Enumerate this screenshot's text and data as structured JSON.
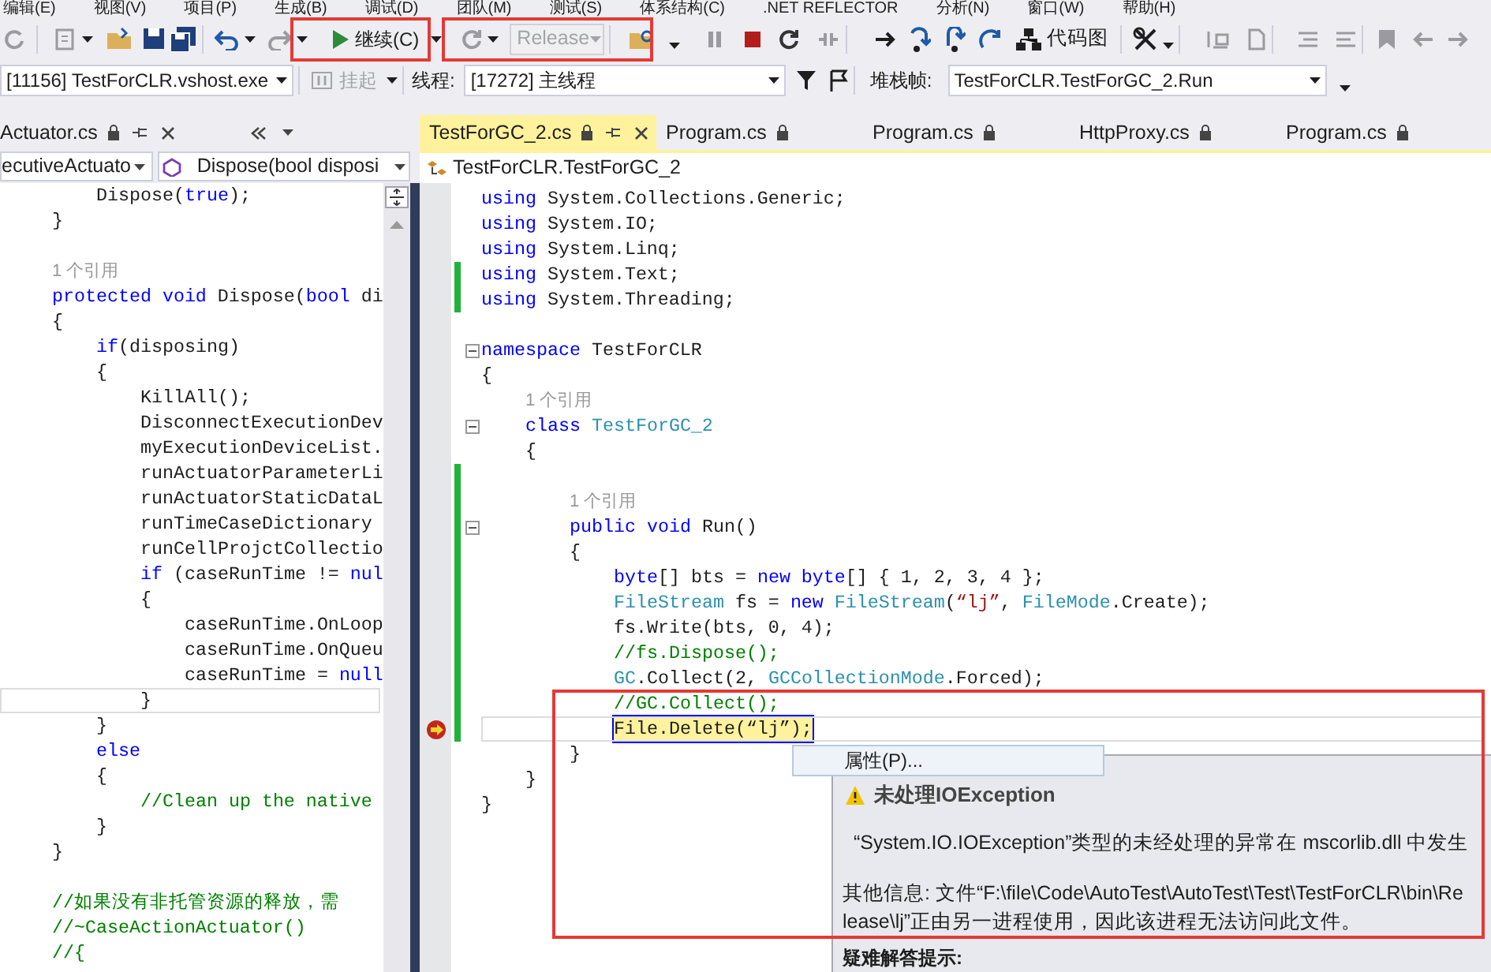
{
  "menu_bar": [
    "编辑(E)",
    "视图(V)",
    "项目(P)",
    "生成(B)",
    "调试(D)",
    "团队(M)",
    "测试(S)",
    "体系结构(C)",
    ".NET REFLECTOR",
    "分析(N)",
    "窗口(W)",
    "帮助(H)"
  ],
  "toolbar": {
    "continue_button": "继续(C)",
    "configuration": {
      "value": "Release",
      "disabled": true
    },
    "code_map_button": "代码图"
  },
  "debug_location": {
    "process": "[11156] TestForCLR.vshost.exe",
    "suspend": {
      "label": "挂起",
      "disabled": true
    },
    "thread_label": "线程:",
    "thread": "[17272] 主线程",
    "stack_frame_label": "堆栈帧:",
    "stack_frame": "TestForCLR.TestForGC_2.Run"
  },
  "left_panel": {
    "tab": "Actuator.cs",
    "type_dropdown": "ecutiveActuato",
    "member_dropdown": "Dispose(bool disposi",
    "lines": [
      {
        "current": false,
        "tokens": [
          {
            "kind": "plain",
            "text": "    Dispose("
          },
          {
            "kind": "kw",
            "text": "true"
          },
          {
            "kind": "plain",
            "text": ");"
          }
        ]
      },
      {
        "current": false,
        "tokens": [
          {
            "kind": "plain",
            "text": "}"
          }
        ]
      },
      {
        "current": false
      },
      {
        "current": false,
        "tokens": [
          {
            "kind": "lens",
            "text": "1 个引用"
          }
        ]
      },
      {
        "current": false,
        "tokens": [
          {
            "kind": "kw",
            "text": "protected void"
          },
          {
            "kind": "plain",
            "text": " Dispose("
          },
          {
            "kind": "kw",
            "text": "bool"
          },
          {
            "kind": "plain",
            "text": " di"
          }
        ]
      },
      {
        "current": false,
        "tokens": [
          {
            "kind": "plain",
            "text": "{"
          }
        ]
      },
      {
        "current": false,
        "tokens": [
          {
            "kind": "kw",
            "text": "    if"
          },
          {
            "kind": "plain",
            "text": "(disposing)"
          }
        ]
      },
      {
        "current": false,
        "tokens": [
          {
            "kind": "plain",
            "text": "    {"
          }
        ]
      },
      {
        "current": false,
        "tokens": [
          {
            "kind": "plain",
            "text": "        KillAll();"
          }
        ]
      },
      {
        "current": false,
        "tokens": [
          {
            "kind": "plain",
            "text": "        DisconnectExecutionDev"
          }
        ]
      },
      {
        "current": false,
        "tokens": [
          {
            "kind": "plain",
            "text": "        myExecutionDeviceList."
          }
        ]
      },
      {
        "current": false,
        "tokens": [
          {
            "kind": "plain",
            "text": "        runActuatorParameterLi"
          }
        ]
      },
      {
        "current": false,
        "tokens": [
          {
            "kind": "plain",
            "text": "        runActuatorStaticDataL"
          }
        ]
      },
      {
        "current": false,
        "tokens": [
          {
            "kind": "plain",
            "text": "        runTimeCaseDictionary"
          }
        ]
      },
      {
        "current": false,
        "tokens": [
          {
            "kind": "plain",
            "text": "        runCellProjctCollectio"
          }
        ]
      },
      {
        "current": false,
        "tokens": [
          {
            "kind": "kw",
            "text": "        if"
          },
          {
            "kind": "plain",
            "text": " (caseRunTime != "
          },
          {
            "kind": "kw",
            "text": "nul"
          }
        ]
      },
      {
        "current": false,
        "tokens": [
          {
            "kind": "plain",
            "text": "        {"
          }
        ]
      },
      {
        "current": false,
        "tokens": [
          {
            "kind": "plain",
            "text": "            caseRunTime.OnLoop"
          }
        ]
      },
      {
        "current": false,
        "tokens": [
          {
            "kind": "plain",
            "text": "            caseRunTime.OnQueu"
          }
        ]
      },
      {
        "current": false,
        "tokens": [
          {
            "kind": "plain",
            "text": "            caseRunTime = "
          },
          {
            "kind": "kw",
            "text": "null"
          }
        ]
      },
      {
        "current": true,
        "tokens": [
          {
            "kind": "plain",
            "text": "        }"
          }
        ]
      },
      {
        "current": false,
        "tokens": [
          {
            "kind": "plain",
            "text": "    }"
          }
        ]
      },
      {
        "current": false,
        "tokens": [
          {
            "kind": "kw",
            "text": "    else"
          }
        ]
      },
      {
        "current": false,
        "tokens": [
          {
            "kind": "plain",
            "text": "    {"
          }
        ]
      },
      {
        "current": false,
        "tokens": [
          {
            "kind": "comment",
            "text": "        //Clean up the native"
          }
        ]
      },
      {
        "current": false,
        "tokens": [
          {
            "kind": "plain",
            "text": "    }"
          }
        ]
      },
      {
        "current": false,
        "tokens": [
          {
            "kind": "plain",
            "text": "}"
          }
        ]
      },
      {
        "current": false
      },
      {
        "current": false,
        "tokens": [
          {
            "kind": "comment",
            "text": "//如果没有非托管资源的释放，需"
          }
        ]
      },
      {
        "current": false,
        "tokens": [
          {
            "kind": "comment",
            "text": "//~CaseActionActuator()"
          }
        ]
      },
      {
        "current": false,
        "tokens": [
          {
            "kind": "comment",
            "text": "//{"
          }
        ]
      }
    ]
  },
  "document_tabs": [
    {
      "label": "TestForGC_2.cs",
      "selected": true
    },
    {
      "label": "Program.cs",
      "selected": false
    },
    {
      "label": "Program.cs",
      "selected": false
    },
    {
      "label": "HttpProxy.cs",
      "selected": false
    },
    {
      "label": "Program.cs",
      "selected": false
    }
  ],
  "editor": {
    "type_dropdown": "TestForCLR.TestForGC_2",
    "lines": [
      {
        "changed": false,
        "fold": false,
        "current": false,
        "execution_point": false,
        "tokens": [
          {
            "kind": "kw",
            "text": "using"
          },
          {
            "kind": "plain",
            "text": " System.Collections.Generic;"
          }
        ]
      },
      {
        "changed": false,
        "fold": false,
        "current": false,
        "execution_point": false,
        "tokens": [
          {
            "kind": "kw",
            "text": "using"
          },
          {
            "kind": "plain",
            "text": " System.IO;"
          }
        ]
      },
      {
        "changed": false,
        "fold": false,
        "current": false,
        "execution_point": false,
        "tokens": [
          {
            "kind": "kw",
            "text": "using"
          },
          {
            "kind": "plain",
            "text": " System.Linq;"
          }
        ]
      },
      {
        "changed": true,
        "fold": false,
        "current": false,
        "execution_point": false,
        "tokens": [
          {
            "kind": "kw",
            "text": "using"
          },
          {
            "kind": "plain",
            "text": " System.Text;"
          }
        ]
      },
      {
        "changed": true,
        "fold": false,
        "current": false,
        "execution_point": false,
        "tokens": [
          {
            "kind": "kw",
            "text": "using"
          },
          {
            "kind": "plain",
            "text": " System.Threading;"
          }
        ]
      },
      {
        "changed": false,
        "fold": false,
        "current": false,
        "execution_point": false
      },
      {
        "changed": false,
        "fold": true,
        "current": false,
        "execution_point": false,
        "tokens": [
          {
            "kind": "kw",
            "text": "namespace"
          },
          {
            "kind": "plain",
            "text": " TestForCLR"
          }
        ]
      },
      {
        "changed": false,
        "fold": false,
        "current": false,
        "execution_point": false,
        "tokens": [
          {
            "kind": "plain",
            "text": "{"
          }
        ]
      },
      {
        "changed": false,
        "fold": false,
        "current": false,
        "execution_point": false,
        "tokens": [
          {
            "kind": "lens",
            "text": "    1 个引用"
          }
        ]
      },
      {
        "changed": false,
        "fold": true,
        "current": false,
        "execution_point": false,
        "tokens": [
          {
            "kind": "kw",
            "text": "    class"
          },
          {
            "kind": "type",
            "text": " TestForGC_2"
          }
        ]
      },
      {
        "changed": false,
        "fold": false,
        "current": false,
        "execution_point": false,
        "tokens": [
          {
            "kind": "plain",
            "text": "    {"
          }
        ]
      },
      {
        "changed": true,
        "fold": false,
        "current": false,
        "execution_point": false
      },
      {
        "changed": true,
        "fold": false,
        "current": false,
        "execution_point": false,
        "tokens": [
          {
            "kind": "lens",
            "text": "        1 个引用"
          }
        ]
      },
      {
        "changed": true,
        "fold": true,
        "current": false,
        "execution_point": false,
        "tokens": [
          {
            "kind": "kw",
            "text": "        public void"
          },
          {
            "kind": "plain",
            "text": " Run()"
          }
        ]
      },
      {
        "changed": true,
        "fold": false,
        "current": false,
        "execution_point": false,
        "tokens": [
          {
            "kind": "plain",
            "text": "        {"
          }
        ]
      },
      {
        "changed": true,
        "fold": false,
        "current": false,
        "execution_point": false,
        "tokens": [
          {
            "kind": "kw",
            "text": "            byte"
          },
          {
            "kind": "plain",
            "text": "[] bts = "
          },
          {
            "kind": "kw",
            "text": "new byte"
          },
          {
            "kind": "plain",
            "text": "[] { 1, 2, 3, 4 };"
          }
        ]
      },
      {
        "changed": true,
        "fold": false,
        "current": false,
        "execution_point": false,
        "tokens": [
          {
            "kind": "type",
            "text": "            FileStream"
          },
          {
            "kind": "plain",
            "text": " fs = "
          },
          {
            "kind": "kw",
            "text": "new"
          },
          {
            "kind": "type",
            "text": " FileStream"
          },
          {
            "kind": "plain",
            "text": "("
          },
          {
            "kind": "str",
            "text": "“lj”"
          },
          {
            "kind": "plain",
            "text": ", "
          },
          {
            "kind": "type",
            "text": "FileMode"
          },
          {
            "kind": "plain",
            "text": ".Create);"
          }
        ]
      },
      {
        "changed": true,
        "fold": false,
        "current": false,
        "execution_point": false,
        "tokens": [
          {
            "kind": "plain",
            "text": "            fs.Write(bts, 0, 4);"
          }
        ]
      },
      {
        "changed": true,
        "fold": false,
        "current": false,
        "execution_point": false,
        "tokens": [
          {
            "kind": "comment",
            "text": "            //fs.Dispose();"
          }
        ]
      },
      {
        "changed": true,
        "fold": false,
        "current": false,
        "execution_point": false,
        "tokens": [
          {
            "kind": "type",
            "text": "            GC"
          },
          {
            "kind": "plain",
            "text": ".Collect(2, "
          },
          {
            "kind": "type",
            "text": "GCCollectionMode"
          },
          {
            "kind": "plain",
            "text": ".Forced);"
          }
        ]
      },
      {
        "changed": true,
        "fold": false,
        "current": false,
        "execution_point": false,
        "tokens": [
          {
            "kind": "comment",
            "text": "            //GC.Collect();"
          }
        ]
      },
      {
        "changed": true,
        "fold": false,
        "current": true,
        "execution_point": true,
        "tokens": [
          {
            "kind": "stmt",
            "text": "            File.Delete(“lj”);"
          }
        ]
      },
      {
        "changed": false,
        "fold": false,
        "current": false,
        "execution_point": false,
        "tokens": [
          {
            "kind": "plain",
            "text": "        }"
          }
        ]
      },
      {
        "changed": false,
        "fold": false,
        "current": false,
        "execution_point": false,
        "tokens": [
          {
            "kind": "plain",
            "text": "    }"
          }
        ]
      },
      {
        "changed": false,
        "fold": false,
        "current": false,
        "execution_point": false,
        "tokens": [
          {
            "kind": "plain",
            "text": "}"
          }
        ]
      }
    ]
  },
  "exception_helper": {
    "context_menu_item": "属性(P)...",
    "title": "未处理IOException",
    "message": "“System.IO.IOException”类型的未经处理的异常在 mscorlib.dll 中发生",
    "details": "其他信息: 文件“F:\\file\\Code\\AutoTest\\AutoTest\\Test\\TestForCLR\\bin\\Release\\lj”正由另一进程使用，因此该进程无法访问此文件。",
    "troubleshooting_heading": "疑难解答提示:"
  }
}
